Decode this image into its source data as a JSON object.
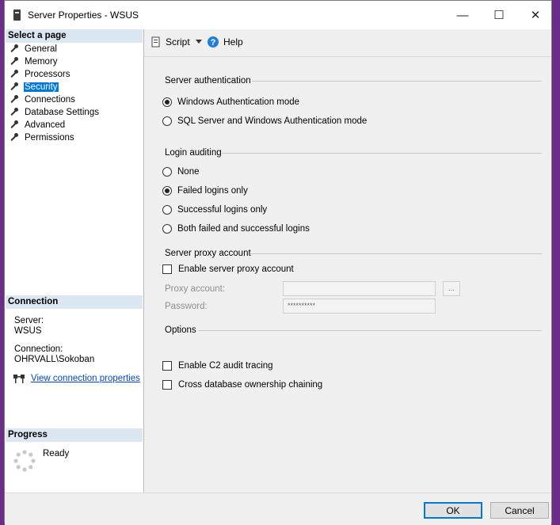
{
  "window": {
    "title": "Server Properties - WSUS"
  },
  "left": {
    "select_page_header": "Select a page",
    "items": [
      {
        "label": "General",
        "selected": false
      },
      {
        "label": "Memory",
        "selected": false
      },
      {
        "label": "Processors",
        "selected": false
      },
      {
        "label": "Security",
        "selected": true
      },
      {
        "label": "Connections",
        "selected": false
      },
      {
        "label": "Database Settings",
        "selected": false
      },
      {
        "label": "Advanced",
        "selected": false
      },
      {
        "label": "Permissions",
        "selected": false
      }
    ],
    "connection_header": "Connection",
    "server_label": "Server:",
    "server_value": "WSUS",
    "connection_label": "Connection:",
    "connection_value": "OHRVALL\\Sokoban",
    "view_link": "View connection properties",
    "progress_header": "Progress",
    "progress_status": "Ready"
  },
  "toolbar": {
    "script": "Script",
    "help": "Help"
  },
  "auth": {
    "title": "Server authentication",
    "options": [
      {
        "label": "Windows Authentication mode",
        "checked": true
      },
      {
        "label": "SQL Server and Windows Authentication mode",
        "checked": false
      }
    ]
  },
  "audit": {
    "title": "Login auditing",
    "options": [
      {
        "label": "None",
        "checked": false
      },
      {
        "label": "Failed logins only",
        "checked": true
      },
      {
        "label": "Successful logins only",
        "checked": false
      },
      {
        "label": "Both failed and successful logins",
        "checked": false
      }
    ]
  },
  "proxy": {
    "title": "Server proxy account",
    "enable_label": "Enable server proxy account",
    "account_label": "Proxy account:",
    "account_value": "",
    "browse_label": "...",
    "password_label": "Password:",
    "password_value": "**********"
  },
  "options": {
    "title": "Options",
    "c2_label": "Enable C2 audit tracing",
    "chaining_label": "Cross database ownership chaining"
  },
  "buttons": {
    "ok": "OK",
    "cancel": "Cancel"
  },
  "colors": {
    "selection": "#0078d7",
    "header_bg": "#dde7f2",
    "link": "#0046c8"
  }
}
